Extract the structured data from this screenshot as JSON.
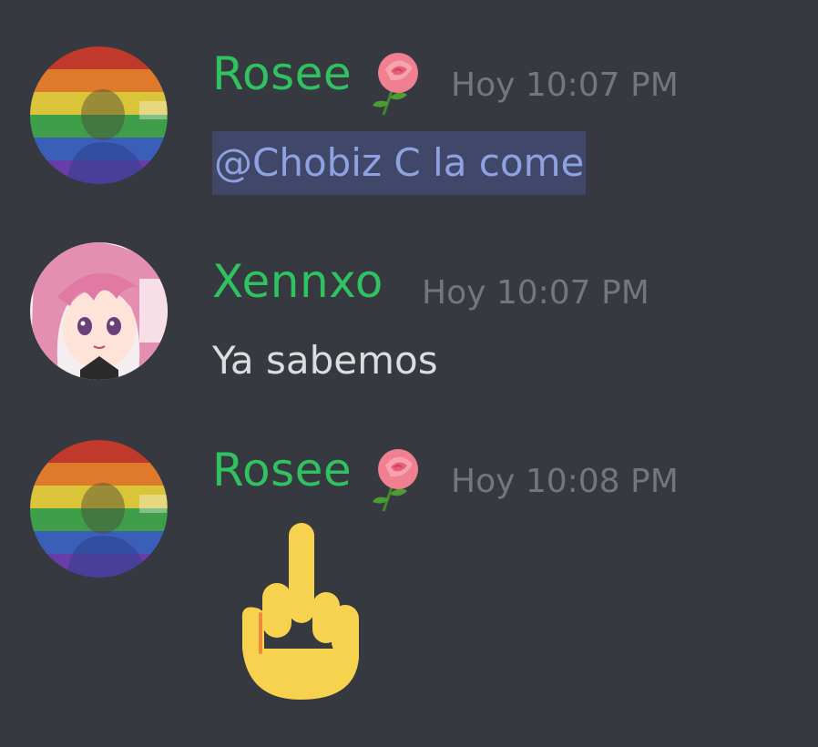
{
  "messages": [
    {
      "username": "Rosee",
      "username_emoji": "rose-icon",
      "timestamp": "Hoy 10:07 PM",
      "avatar": "pride-flag-avatar",
      "content": "@Chobiz C la come",
      "content_type": "mention"
    },
    {
      "username": "Xennxo",
      "timestamp": "Hoy 10:07 PM",
      "avatar": "anime-pink-hair-avatar",
      "content": "Ya sabemos",
      "content_type": "text"
    },
    {
      "username": "Rosee",
      "username_emoji": "rose-icon",
      "timestamp": "Hoy 10:08 PM",
      "avatar": "pride-flag-avatar",
      "content_emoji": "middle-finger-icon",
      "content_type": "emoji"
    }
  ],
  "colors": {
    "background": "#36393f",
    "username": "#30c261",
    "timestamp": "#72767d",
    "message_text": "#dcddde",
    "mention_text": "#8ea1e1",
    "mention_bg": "#414769"
  }
}
